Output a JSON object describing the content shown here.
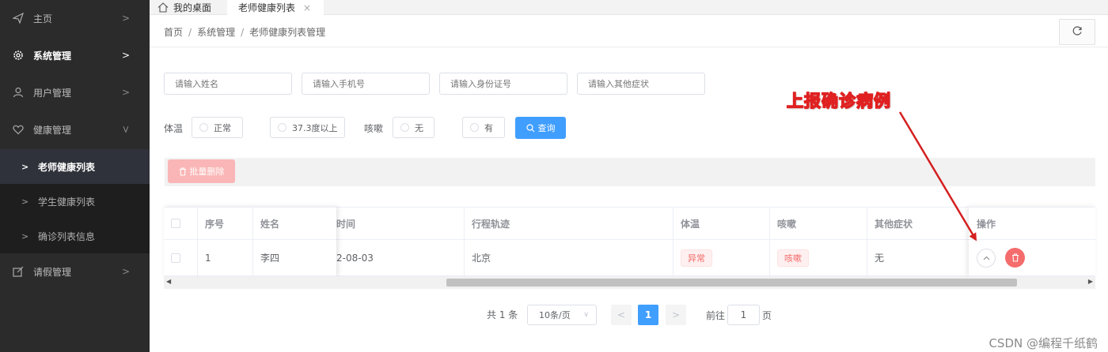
{
  "sidebar": {
    "items": [
      {
        "icon": "paper-plane-icon",
        "label": "主页"
      },
      {
        "icon": "gear-icon",
        "label": "系统管理"
      },
      {
        "icon": "user-icon",
        "label": "用户管理"
      },
      {
        "icon": "heart-icon",
        "label": "健康管理"
      },
      {
        "icon": "edit-icon",
        "label": "请假管理"
      }
    ],
    "health_sub": [
      {
        "label": "老师健康列表",
        "active": true
      },
      {
        "label": "学生健康列表"
      },
      {
        "label": "确诊列表信息"
      }
    ]
  },
  "tabs": {
    "home": "我的桌面",
    "active": "老师健康列表"
  },
  "breadcrumb": [
    "首页",
    "系统管理",
    "老师健康列表管理"
  ],
  "search": {
    "name_placeholder": "请输入姓名",
    "phone_placeholder": "请输入手机号",
    "id_placeholder": "请输入身份证号",
    "symptom_placeholder": "请输入其他症状",
    "temp_label": "体温",
    "temp_opt1": "正常",
    "temp_opt2": "37.3度以上",
    "cough_label": "咳嗽",
    "cough_opt1": "无",
    "cough_opt2": "有",
    "search_button": "查询"
  },
  "toolbar": {
    "batch_delete": "批量删除"
  },
  "table": {
    "headers": {
      "index": "序号",
      "name": "姓名",
      "time": "时间",
      "trip": "行程轨迹",
      "temp": "体温",
      "cough": "咳嗽",
      "other": "其他症状",
      "op": "操作"
    },
    "rows": [
      {
        "index": "1",
        "name": "李四",
        "time": "2-08-03",
        "trip": "北京",
        "temp": "异常",
        "cough": "咳嗽",
        "other": "无"
      }
    ]
  },
  "pagination": {
    "total": "共 1 条",
    "page_size": "10条/页",
    "current": "1",
    "goto_label": "前往",
    "goto_value": "1",
    "goto_unit": "页"
  },
  "annotation": {
    "text": "上报确诊病例",
    "color": "#e02020"
  },
  "watermark": "CSDN @编程千纸鹤",
  "colors": {
    "primary": "#409eff",
    "danger": "#f56c6c",
    "sidebar_bg": "#2b2b2b"
  }
}
